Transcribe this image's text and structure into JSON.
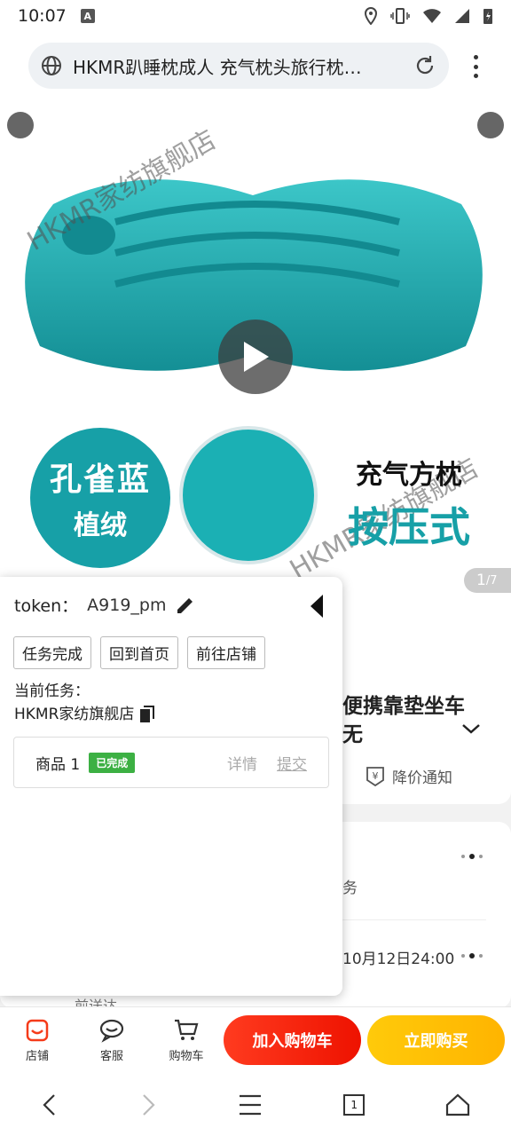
{
  "status": {
    "time": "10:07",
    "notif_letter": "A"
  },
  "browser": {
    "page_title": "HKMR趴睡枕成人 充气枕头旅行枕…"
  },
  "gallery": {
    "counter_current": "1",
    "counter_total": "/7",
    "badge_line1": "孔雀蓝",
    "badge_line2": "植绒",
    "side_line1": "充气方枕",
    "side_line2": "按压式",
    "watermark": "HKMR家纺旗舰店"
  },
  "product": {
    "title_line1": "便携靠垫坐车",
    "title_line2": "无",
    "price_alert": "降价通知"
  },
  "service": {
    "text1": "务",
    "text2": "10月12日24:00",
    "text3": "前送达"
  },
  "overlay": {
    "token_label": "token：",
    "token_value": "A919_pm",
    "buttons": [
      "任务完成",
      "回到首页",
      "前往店铺"
    ],
    "current_task_label": "当前任务：",
    "shop_name": "HKMR家纺旗舰店",
    "goods_label": "商品 1",
    "goods_status": "已完成",
    "detail_label": "详情",
    "submit_label": "提交"
  },
  "bottom": {
    "shop": "店铺",
    "service": "客服",
    "cart": "购物车",
    "add_cart": "加入购物车",
    "buy_now": "立即购买"
  },
  "nav": {
    "tabs_count": "1"
  }
}
